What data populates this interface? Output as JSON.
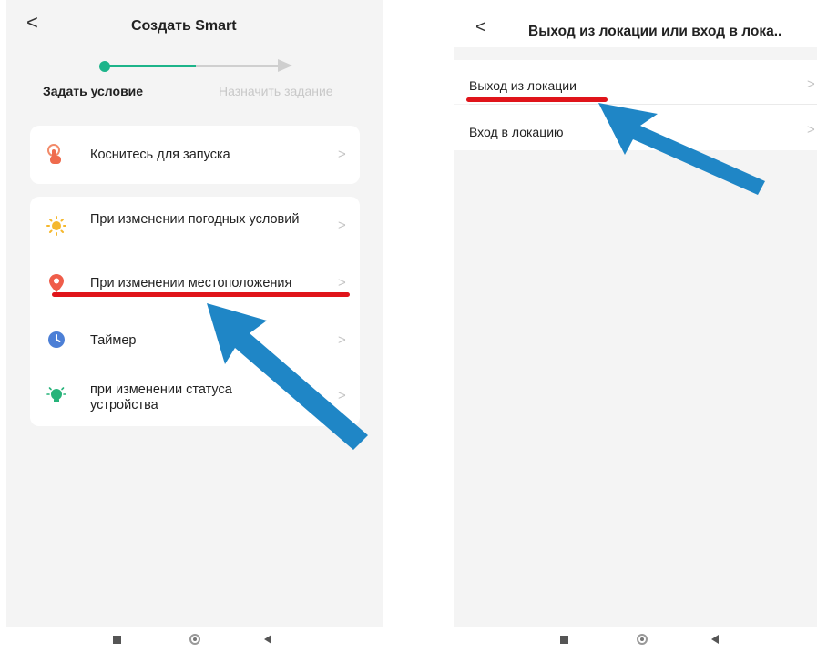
{
  "left_screen": {
    "header": {
      "title": "Создать Smart",
      "back_glyph": "<"
    },
    "stepper": {
      "step1_label": "Задать условие",
      "step2_label": "Назначить задание"
    },
    "items": [
      {
        "label": "Коснитесь для запуска",
        "icon": "touch-hand-icon"
      },
      {
        "label": "При изменении погодных условий",
        "icon": "sun-icon"
      },
      {
        "label": "При изменении местоположения",
        "icon": "location-pin-icon"
      },
      {
        "label": "Таймер",
        "icon": "clock-icon"
      },
      {
        "label": "при изменении статуса устройства",
        "icon": "device-bulb-icon"
      }
    ],
    "chevron": ">"
  },
  "right_screen": {
    "header": {
      "title": "Выход из локации или вход в лока..",
      "back_glyph": "<"
    },
    "items": [
      {
        "label": "Выход из локации"
      },
      {
        "label": "Вход в локацию"
      }
    ],
    "chevron": ">"
  },
  "colors": {
    "accent_green": "#1db48a",
    "underline_red": "#e0141a",
    "arrow_blue": "#1f86c6",
    "screen_bg": "#f4f4f4"
  }
}
